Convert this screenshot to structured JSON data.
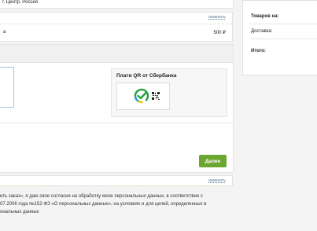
{
  "address": {
    "text": "г, Центр, Россия"
  },
  "delivery": {
    "change_link": "изменить",
    "label": "а",
    "price": "500 ₽"
  },
  "payment": {
    "qr_title": "Плати QR от Сбербанка",
    "next_button": "Далее"
  },
  "bottom": {
    "change_link": "изменить"
  },
  "consent": {
    "line1": "ить заказ», я даю свое согласие на обработку моих персональных данных, в соответствии с",
    "line2": "07.2006 года №152-ФЗ «О персональных данных», на условиях и для целей, определенных в",
    "line3": "ональных данных"
  },
  "summary": {
    "items_label": "Товаров на:",
    "delivery_label": "Доставка:",
    "total_label": "Итого:"
  },
  "colors": {
    "accent_green": "#6aa630",
    "border_green": "#b6d487"
  }
}
